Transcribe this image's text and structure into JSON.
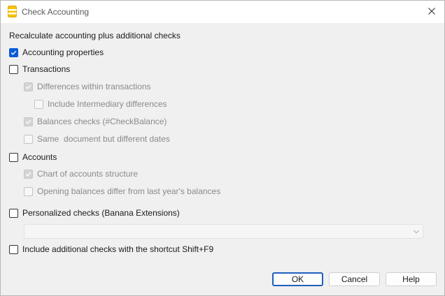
{
  "window": {
    "title": "Check Accounting"
  },
  "heading": "Recalculate accounting plus additional checks",
  "options": {
    "accounting_properties": {
      "label": "Accounting properties",
      "checked": true,
      "enabled": true
    },
    "transactions": {
      "label": "Transactions",
      "checked": false,
      "enabled": true
    },
    "differences_within_transactions": {
      "label": "Differences within transactions",
      "checked": true,
      "enabled": false
    },
    "include_intermediary_differences": {
      "label": "Include Intermediary differences",
      "checked": false,
      "enabled": false
    },
    "balances_checks": {
      "label": "Balances checks (#CheckBalance)",
      "checked": true,
      "enabled": false
    },
    "same_document_different_dates": {
      "label": "Same  document but different dates",
      "checked": false,
      "enabled": false
    },
    "accounts": {
      "label": "Accounts",
      "checked": false,
      "enabled": true
    },
    "chart_of_accounts_structure": {
      "label": "Chart of accounts structure",
      "checked": true,
      "enabled": false
    },
    "opening_balances_differ": {
      "label": "Opening balances differ from last year's balances",
      "checked": false,
      "enabled": false
    },
    "personalized_checks": {
      "label": "Personalized checks (Banana Extensions)",
      "checked": false,
      "enabled": true
    },
    "include_additional_checks": {
      "label": "Include additional checks with the shortcut Shift+F9",
      "checked": false,
      "enabled": true
    }
  },
  "extension_select": {
    "value": "",
    "enabled": false
  },
  "buttons": {
    "ok": "OK",
    "cancel": "Cancel",
    "help": "Help"
  },
  "colors": {
    "accent": "#0a5bd6",
    "default_button_border": "#1f5fbf",
    "app_icon": "#f5c400"
  },
  "icons": {
    "app": "banana-app-icon",
    "close": "close-icon",
    "dropdown": "chevron-down-icon",
    "check": "checkmark-icon"
  }
}
